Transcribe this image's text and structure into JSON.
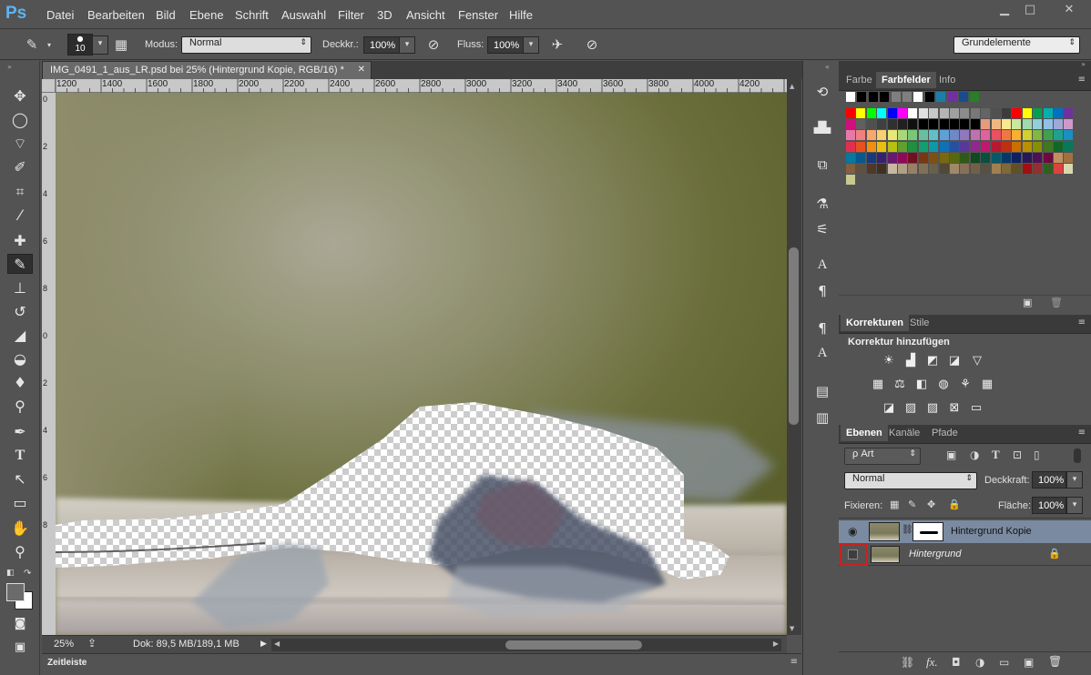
{
  "app": {
    "logo": "Ps"
  },
  "menu": [
    "Datei",
    "Bearbeiten",
    "Bild",
    "Ebene",
    "Schrift",
    "Auswahl",
    "Filter",
    "3D",
    "Ansicht",
    "Fenster",
    "Hilfe"
  ],
  "window_controls": {
    "minimize": "▁",
    "maximize": "□",
    "close": "✕"
  },
  "options": {
    "brush_size": "10",
    "mode_label": "Modus:",
    "mode_value": "Normal",
    "opacity_label": "Deckkr.:",
    "opacity_value": "100%",
    "flow_label": "Fluss:",
    "flow_value": "100%",
    "workspace": "Grundelemente"
  },
  "document": {
    "tab_title": "IMG_0491_1_aus_LR.psd bei 25% (Hintergrund Kopie, RGB/16) *",
    "ruler_h": [
      "1200",
      "1400",
      "1600",
      "1800",
      "2000",
      "2200",
      "2400",
      "2600",
      "2800",
      "3000",
      "3200",
      "3400",
      "3600",
      "3800",
      "4000",
      "4200"
    ],
    "ruler_v": [
      "0",
      "2",
      "4",
      "6",
      "8",
      "0",
      "2",
      "4",
      "6",
      "8"
    ],
    "zoom": "25%",
    "doc_info": "Dok: 89,5 MB/189,1 MB"
  },
  "timeline": {
    "label": "Zeitleiste"
  },
  "panels": {
    "color_tabs": [
      "Farbe",
      "Farbfelder",
      "Info"
    ],
    "adjust_tabs": [
      "Korrekturen",
      "Stile"
    ],
    "adjust_title": "Korrektur hinzufügen",
    "layer_tabs": [
      "Ebenen",
      "Kanäle",
      "Pfade"
    ],
    "filter_kind": "ρ Art",
    "blend_mode": "Normal",
    "opacity_label": "Deckkraft:",
    "opacity_value": "100%",
    "lock_label": "Fixieren:",
    "fill_label": "Fläche:",
    "fill_value": "100%",
    "layers": [
      {
        "name": "Hintergrund Kopie",
        "visible": true,
        "selected": true
      },
      {
        "name": "Hintergrund",
        "visible": false,
        "selected": false,
        "locked": true
      }
    ]
  },
  "colors": {
    "accent_highlight": "#cc2020",
    "selected_layer": "#7a8aa0"
  }
}
